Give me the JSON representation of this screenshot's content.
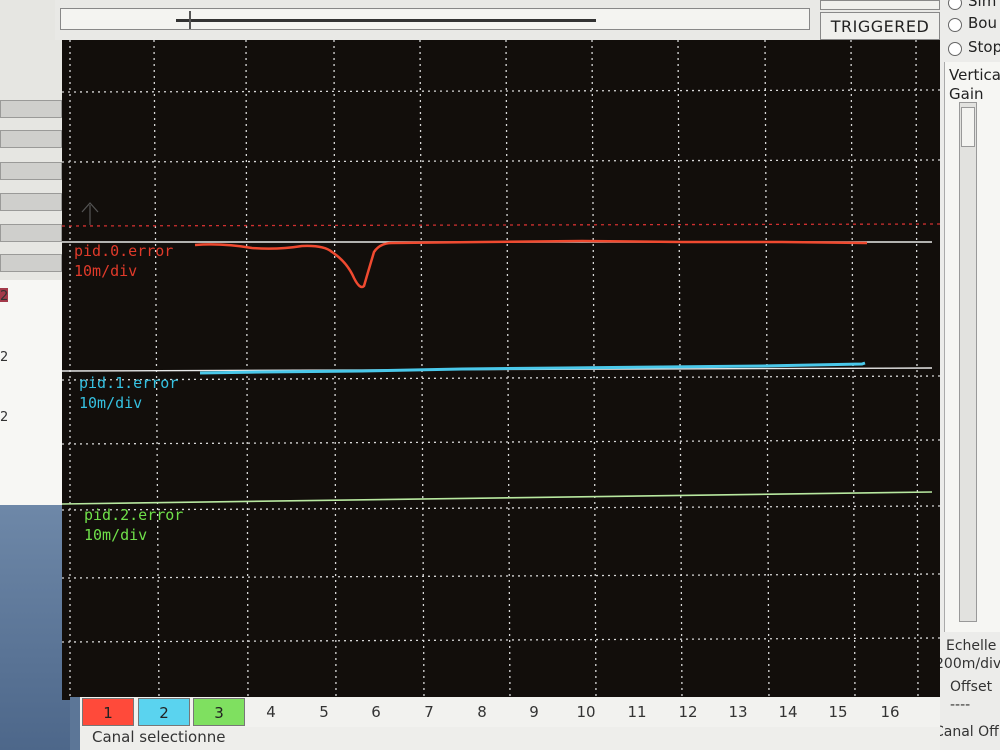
{
  "top": {
    "trigger_status": "TRIGGERED"
  },
  "right_panel": {
    "radio_options": [
      "Sim",
      "Bou",
      "Stop"
    ],
    "vertical_label": "Vertica",
    "gain_label": "Gain",
    "scale_label": "Echelle",
    "scale_value": "200m/div",
    "offset_label": "Offset",
    "offset_value": "----",
    "canal_offset_label": "Canal Off"
  },
  "left_panel": {
    "values": [
      "2",
      "2",
      "2"
    ]
  },
  "scope": {
    "traces": [
      {
        "name": "pid.0.error",
        "scale": "10m/div",
        "color": "#e03a2a"
      },
      {
        "name": "pid.1.error",
        "scale": "10m/div",
        "color": "#35c0e0"
      },
      {
        "name": "pid.2.error",
        "scale": "10m/div",
        "color": "#6fe04a"
      }
    ]
  },
  "channels": {
    "buttons": [
      {
        "label": "1",
        "color": "#ff4a3a"
      },
      {
        "label": "2",
        "color": "#5ad3ef"
      },
      {
        "label": "3",
        "color": "#7fe060"
      }
    ],
    "numbers": [
      "4",
      "5",
      "6",
      "7",
      "8",
      "9",
      "10",
      "11",
      "12",
      "13",
      "14",
      "15",
      "16"
    ]
  },
  "status": {
    "selected_channel": "Canal selectionne"
  }
}
